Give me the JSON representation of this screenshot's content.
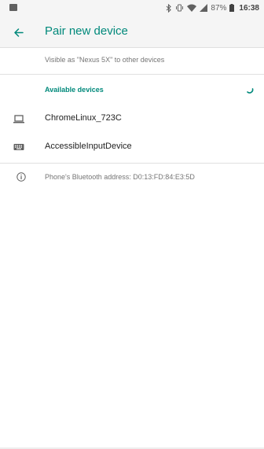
{
  "status_bar": {
    "battery_percent": "87%",
    "time": "16:38",
    "icons": [
      "image-notification-icon",
      "bluetooth-icon",
      "vibrate-icon",
      "wifi-icon",
      "signal-icon",
      "battery-icon"
    ]
  },
  "app_bar": {
    "title": "Pair new device",
    "back_icon": "arrow-back-icon"
  },
  "visible_as": "Visible as \"Nexus 5X\" to other devices",
  "available_devices": {
    "header": "Available devices",
    "items": [
      {
        "label": "ChromeLinux_723C",
        "icon": "laptop-icon"
      },
      {
        "label": "AccessibleInputDevice",
        "icon": "keyboard-icon"
      }
    ]
  },
  "bluetooth_address": "Phone's Bluetooth address: D0:13:FD:84:E3:5D",
  "colors": {
    "accent": "#00897b",
    "bar_background": "#f5f5f5",
    "divider": "#e0e0e0"
  }
}
